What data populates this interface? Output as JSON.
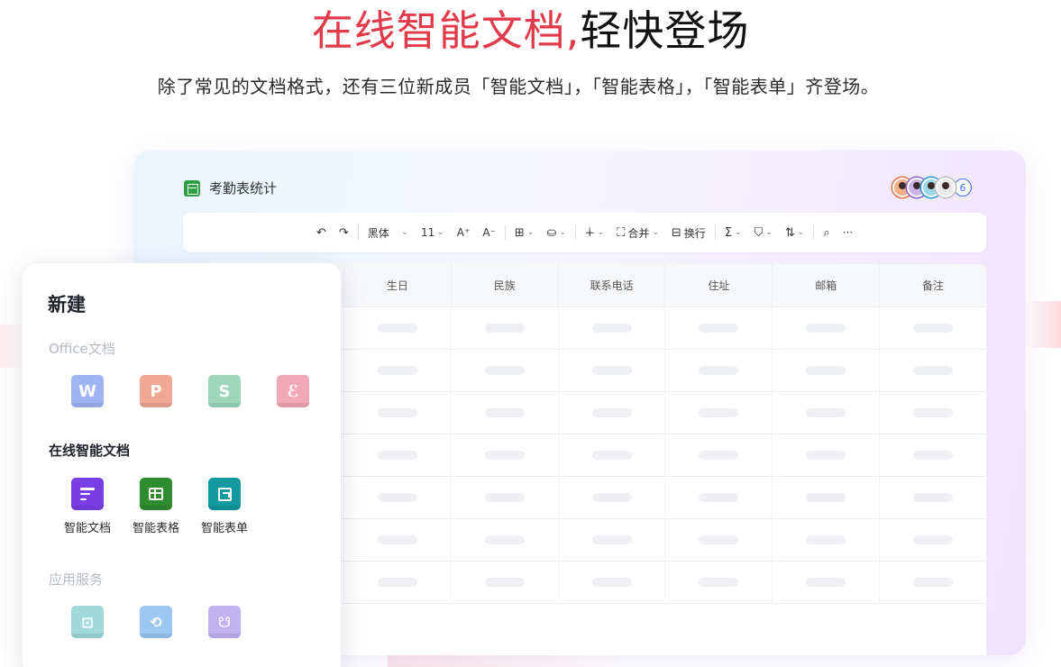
{
  "hero": {
    "title_accent": "在线智能文档,",
    "title_plain": "轻快登场",
    "subtitle": "除了常见的文档格式，还有三位新成员「智能文档」，「智能表格」，「智能表单」齐登场。"
  },
  "sheet": {
    "title": "考勤表统计",
    "collaborator_count": "6"
  },
  "toolbar": {
    "undo": "↶",
    "redo": "↷",
    "font": "黑体",
    "font_size": "11",
    "increase_font": "A⁺",
    "decrease_font": "A⁻",
    "merge": "合并",
    "wrap": "换行",
    "sum": "Σ",
    "more": "···"
  },
  "grid": {
    "columns": [
      "生日",
      "民族",
      "联系电话",
      "住址",
      "邮箱",
      "备注"
    ]
  },
  "panel": {
    "title": "新建",
    "office_section": "Office文档",
    "office_apps": [
      {
        "letter": "W"
      },
      {
        "letter": "P"
      },
      {
        "letter": "S"
      },
      {
        "letter": "ℰ"
      }
    ],
    "smart_section": "在线智能文档",
    "smart_apps": [
      {
        "label": "智能文档"
      },
      {
        "label": "智能表格"
      },
      {
        "label": "智能表单"
      }
    ],
    "service_section": "应用服务"
  },
  "colors": {
    "accent": "#e23a4a",
    "sheet_green": "#2e8b2e",
    "doc_purple": "#7a3ee6",
    "form_teal": "#129aa0"
  }
}
